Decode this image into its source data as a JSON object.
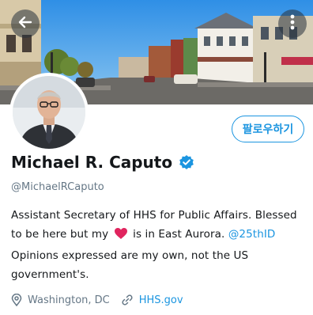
{
  "header": {
    "back_icon": "arrow-left-icon",
    "more_icon": "vertical-ellipsis-icon",
    "banner": "town main street with shops and parked cars"
  },
  "profile": {
    "display_name": "Michael R. Caputo",
    "verified": true,
    "handle": "@MichaelRCaputo",
    "follow_label": "팔로우하기",
    "bio": {
      "line_part1": "Assistant Secretary of HHS for Public Affairs. Blessed to be here but my",
      "line_part2": "is in East Aurora.",
      "mention": "@25thID",
      "line_part3": "Opinions expressed are my own, not the US government's."
    },
    "location": "Washington, DC",
    "website": "HHS.gov"
  },
  "colors": {
    "accent": "#1b95e0",
    "text": "#14171a",
    "secondary": "#657786",
    "heart": "#e0245e"
  }
}
